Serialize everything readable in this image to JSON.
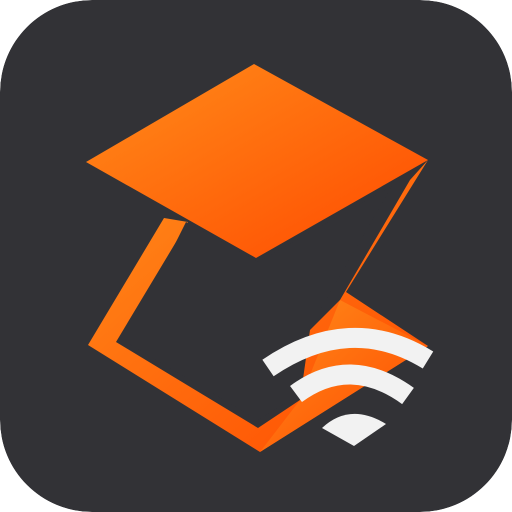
{
  "icon": {
    "name": "app-icon",
    "semantic": "graduation-cap-wifi-logo",
    "colors": {
      "background": "#323236",
      "orange_light": "#ff8c1a",
      "orange_dark": "#ff4a00",
      "wifi": "#f2f2f2"
    }
  }
}
